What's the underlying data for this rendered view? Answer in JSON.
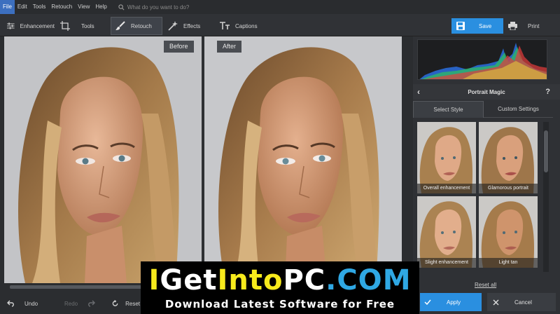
{
  "menubar": {
    "items": [
      "File",
      "Edit",
      "Tools",
      "Retouch",
      "View",
      "Help"
    ],
    "search_placeholder": "What do you want to do?"
  },
  "toolbar": {
    "tabs": [
      {
        "label": "Enhancement",
        "icon": "sliders-icon"
      },
      {
        "label": "Tools",
        "icon": "crop-icon"
      },
      {
        "label": "Retouch",
        "icon": "brush-icon",
        "selected": true
      },
      {
        "label": "Effects",
        "icon": "magic-wand-icon"
      },
      {
        "label": "Captions",
        "icon": "text-icon"
      }
    ],
    "save_label": "Save",
    "print_label": "Print"
  },
  "canvas": {
    "before_label": "Before",
    "after_label": "After"
  },
  "panel": {
    "title": "Portrait Magic",
    "help": "?",
    "tabs": [
      "Select Style",
      "Custom Settings"
    ],
    "active_tab": "Select Style",
    "styles": [
      "Overall enhancement",
      "Glamorous portrait",
      "Slight enhancement",
      "Light tan"
    ],
    "reset_all": "Reset all"
  },
  "bottombar": {
    "undo": "Undo",
    "redo": "Redo",
    "reset": "Reset",
    "apply": "Apply",
    "cancel": "Cancel"
  },
  "watermark": {
    "logo_parts": [
      "I",
      "Get",
      "Into",
      "PC",
      ".",
      "COM"
    ],
    "tagline": "Download Latest Software for Free"
  },
  "colors": {
    "accent": "#2a8fe0",
    "menu_active": "#3c6fbf",
    "watermark_yellow": "#f7ea1c",
    "watermark_blue": "#2fa8e4"
  }
}
